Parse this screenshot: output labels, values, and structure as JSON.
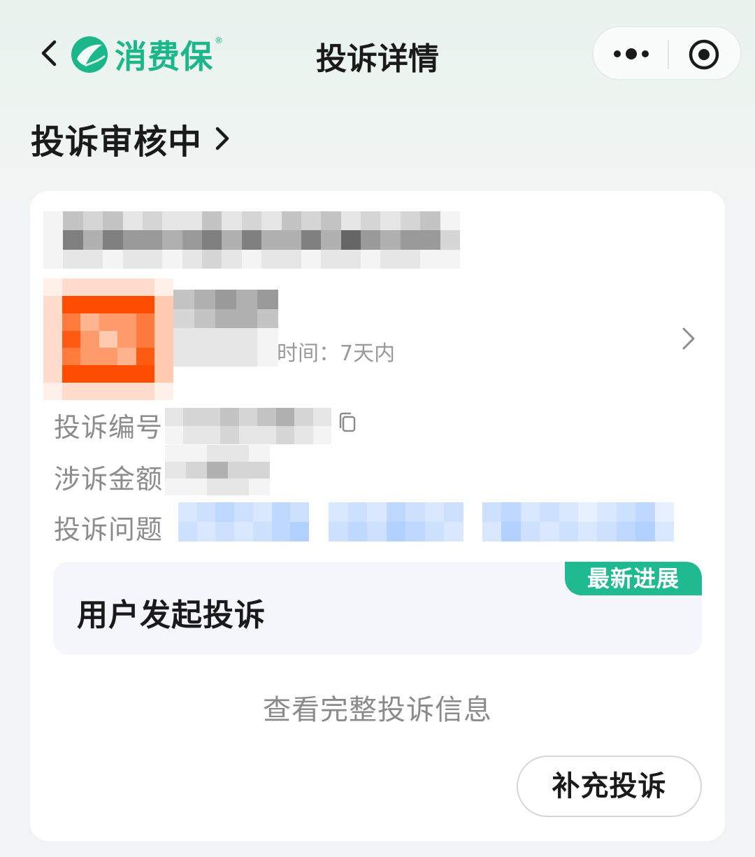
{
  "nav": {
    "brand_name": "消费保",
    "brand_mark": "®",
    "title": "投诉详情"
  },
  "status": {
    "text": "投诉审核中"
  },
  "product": {
    "time_label": "时间：7天内"
  },
  "info": {
    "number_label": "投诉编号",
    "amount_label": "涉诉金额",
    "issue_label": "投诉问题"
  },
  "progress": {
    "badge": "最新进展",
    "title": "用户发起投诉"
  },
  "actions": {
    "view_full": "查看完整投诉信息",
    "supplement": "补充投诉"
  },
  "colors": {
    "brand": "#1bb68a",
    "badge": "#1fba90",
    "page_bg": "#f2f3f5",
    "card_bg": "#ffffff",
    "progress_bg": "#f5f6fb"
  },
  "icons": {
    "back": "chevron-left-icon",
    "more": "more-dots-icon",
    "close": "target-circle-icon",
    "status_arrow": "chevron-right-icon",
    "copy": "copy-icon"
  }
}
